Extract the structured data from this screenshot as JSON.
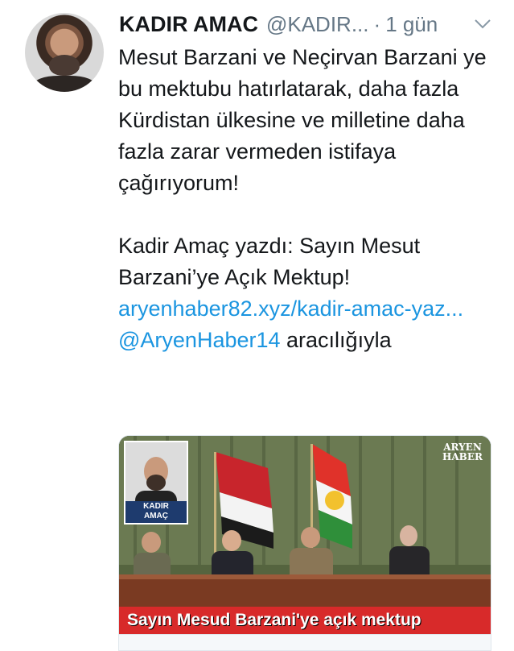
{
  "tweet": {
    "author_name": "KADIR AMAC",
    "handle": "@KADIR...",
    "separator": "·",
    "time": "1 gün",
    "paragraph1": "Mesut Barzani ve Neçirvan Barzani ye bu mektubu hatırlatarak, daha fazla Kürdistan ülkesine ve milletine daha fazla zarar vermeden istifaya çağırıyorum!",
    "paragraph2_text": "Kadir Amaç yazdı: Sayın Mesut Barzani’ye Açık Mektup!",
    "link_url": "aryenhaber82.xyz/kadir-amac-yaz...",
    "link_mention": "@AryenHaber14",
    "trailing": "aracılığıyla"
  },
  "card": {
    "caption": "Sayın Mesud Barzani'ye açık mektup",
    "portrait_label_line1": "KADIR",
    "portrait_label_line2": "AMAÇ",
    "brand_line1": "ARYEN",
    "brand_line2": "HABER"
  },
  "colors": {
    "link": "#1b95e0",
    "meta": "#657786",
    "text": "#14171a",
    "caption_bg": "#d82a2a"
  },
  "icons": [
    "chevron-down-icon"
  ]
}
